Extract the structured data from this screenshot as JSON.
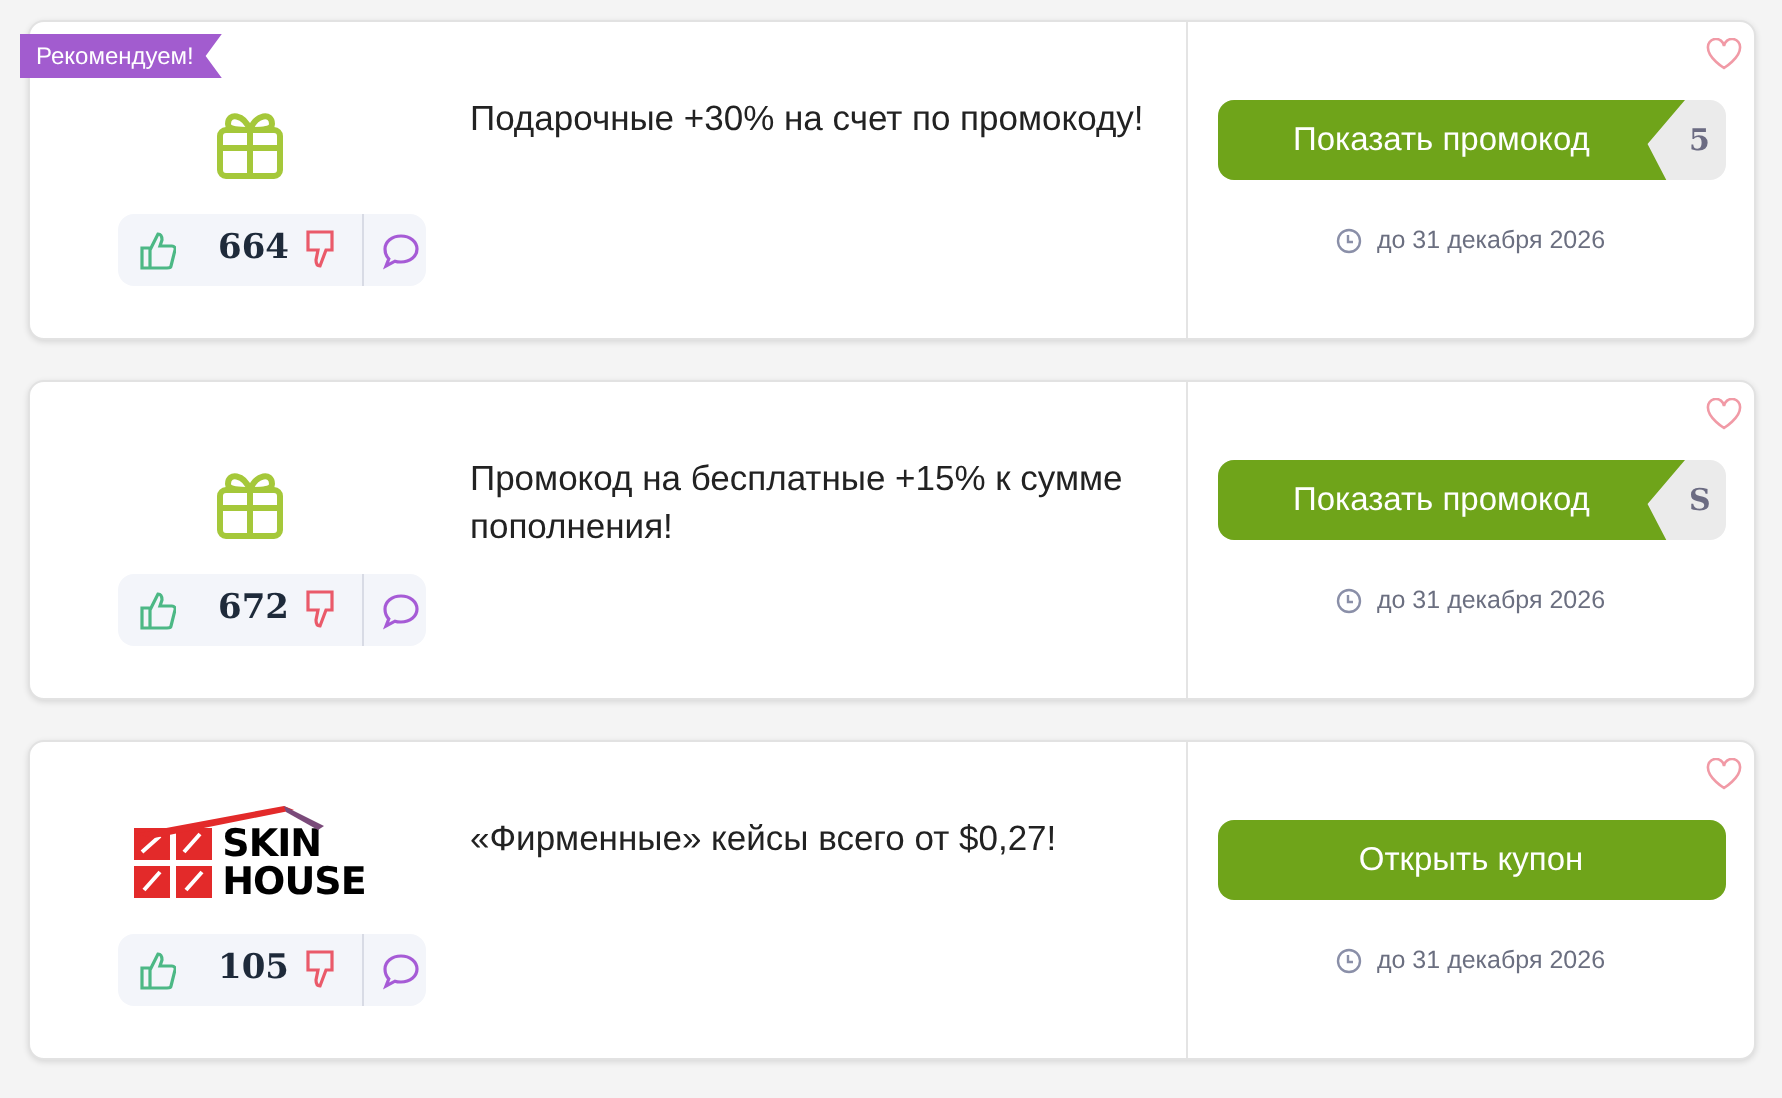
{
  "offers": [
    {
      "badge": "Рекомендуем!",
      "logo": {
        "kind": "gift"
      },
      "likes": "664",
      "text": "Подарочные +30% на счет по промокоду!",
      "button": {
        "kind": "promo",
        "label": "Показать промокод",
        "code_peek": "5"
      },
      "expires": "до 31 декабря 2026",
      "favorite": false
    },
    {
      "logo": {
        "kind": "gift"
      },
      "likes": "672",
      "text": "Промокод на бесплатные +15% к сумме пополнения!",
      "button": {
        "kind": "promo",
        "label": "Показать промокод",
        "code_peek": "S"
      },
      "expires": "до 31 декабря 2026",
      "favorite": false
    },
    {
      "logo": {
        "kind": "brand",
        "lines": [
          "SKIN",
          "HOUSE"
        ]
      },
      "likes": "105",
      "text": "«Фирменные» кейсы всего от $0,27!",
      "button": {
        "kind": "coupon",
        "label": "Открыть купон"
      },
      "expires": "до 31 декабря 2026",
      "favorite": false
    }
  ]
}
